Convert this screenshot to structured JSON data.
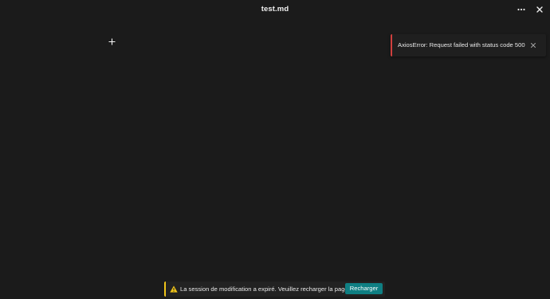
{
  "window": {
    "title": "test.md"
  },
  "toast": {
    "message": "AxiosError: Request failed with status code 500",
    "accent": "#d0403e"
  },
  "banner": {
    "message": "La session de modification a expiré. Veuillez recharger la page.",
    "action_label": "Recharger",
    "accent": "#f0c419",
    "button_color": "#0f7f83"
  },
  "icons": {
    "menu": "more-horizontal-icon",
    "close": "close-icon",
    "toast_close": "close-icon",
    "warning": "warning-icon",
    "cursor": "crosshair-cursor-icon"
  }
}
